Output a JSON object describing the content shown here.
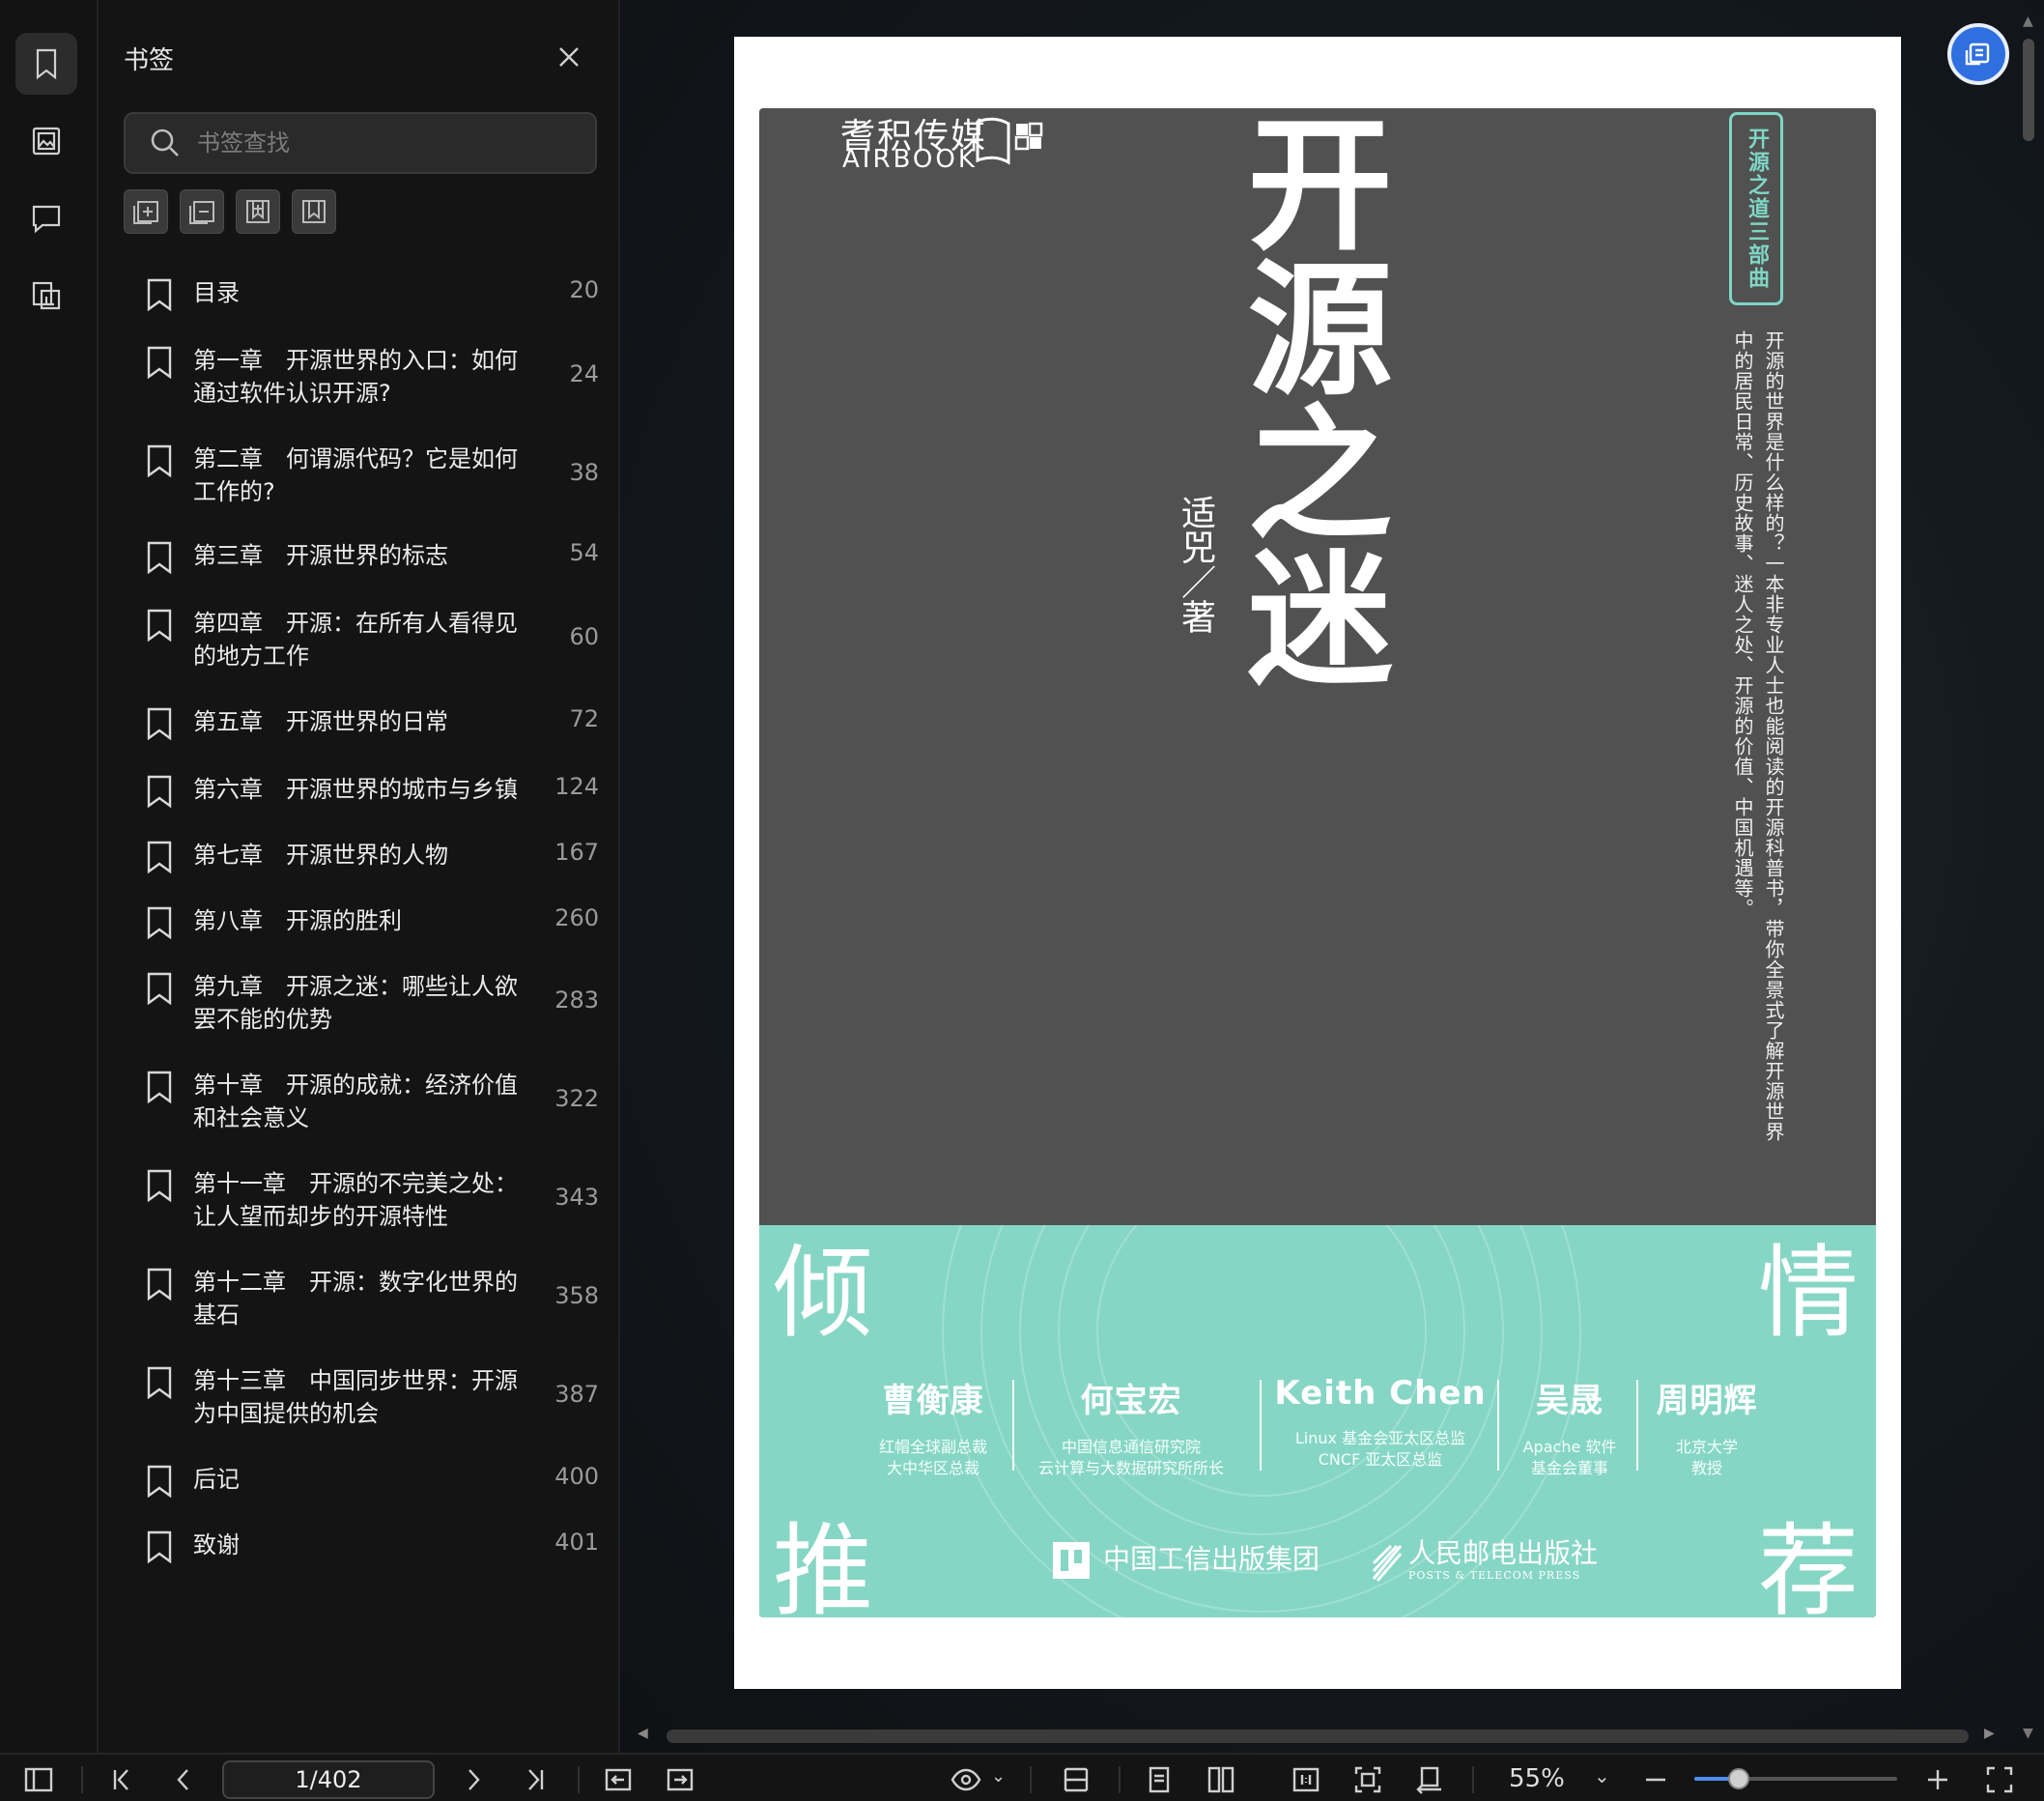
{
  "sidebar": {
    "title": "书签",
    "search_placeholder": "书签查找",
    "rail_icons": [
      "bookmark-icon",
      "image-icon",
      "comment-icon",
      "page-thumbnail-icon"
    ],
    "tool_icons": [
      "expand-all-icon",
      "collapse-all-icon",
      "add-bookmark-icon",
      "remove-bookmark-icon"
    ],
    "bookmarks": [
      {
        "label": "目录",
        "page": "20"
      },
      {
        "label": "第一章　开源世界的入口：如何\n通过软件认识开源?",
        "page": "24"
      },
      {
        "label": "第二章　何谓源代码？它是如何\n工作的?",
        "page": "38"
      },
      {
        "label": "第三章　开源世界的标志",
        "page": "54"
      },
      {
        "label": "第四章　开源：在所有人看得见\n的地方工作",
        "page": "60"
      },
      {
        "label": "第五章　开源世界的日常",
        "page": "72"
      },
      {
        "label": "第六章　开源世界的城市与乡镇",
        "page": "124"
      },
      {
        "label": "第七章　开源世界的人物",
        "page": "167"
      },
      {
        "label": "第八章　开源的胜利",
        "page": "260"
      },
      {
        "label": "第九章　开源之迷：哪些让人欲\n罢不能的优势",
        "page": "283"
      },
      {
        "label": "第十章　开源的成就：经济价值\n和社会意义",
        "page": "322"
      },
      {
        "label": "第十一章　开源的不完美之处：\n让人望而却步的开源特性",
        "page": "343"
      },
      {
        "label": "第十二章　开源：数字化世界的\n基石",
        "page": "358"
      },
      {
        "label": "第十三章　中国同步世界：开源\n为中国提供的机会",
        "page": "387"
      },
      {
        "label": "后记",
        "page": "400"
      },
      {
        "label": "致谢",
        "page": "401"
      }
    ]
  },
  "cover": {
    "logo_cn": "耆积传媒",
    "logo_en": "AIRBOOK",
    "title": "开源之迷",
    "author": "适兕／著",
    "series": "开源之道三部曲",
    "blurb": "开源的世界是什么样的？一本非专业人士也能阅读的开源科普书，带你全景式了解开源世界中的居民日常、历史故事、迷人之处、开源的价值、中国机遇等。",
    "band_chars": [
      "倾",
      "情",
      "推",
      "荐"
    ],
    "recommenders": [
      {
        "name": "曹衡康",
        "title1": "红帽全球副总裁",
        "title2": "大中华区总裁"
      },
      {
        "name": "何宝宏",
        "title1": "中国信息通信研究院",
        "title2": "云计算与大数据研究所所长"
      },
      {
        "name": "Keith Chen",
        "title1": "Linux 基金会亚太区总监",
        "title2": "CNCF 亚太区总监"
      },
      {
        "name": "吴晟",
        "title1": "Apache 软件",
        "title2": "基金会董事"
      },
      {
        "name": "周明辉",
        "title1": "北京大学",
        "title2": "教授"
      }
    ],
    "press1": "中国工信出版集团",
    "press2": "人民邮电出版社",
    "press2_en": "POSTS & TELECOM PRESS",
    "band_color": "#86d6c5",
    "cover_color": "#515151"
  },
  "toolbar": {
    "page_indicator": "1/402",
    "zoom": "55%",
    "zoom_fraction": 0.22,
    "caret": "⌄"
  },
  "accent": "#2f6fe0"
}
